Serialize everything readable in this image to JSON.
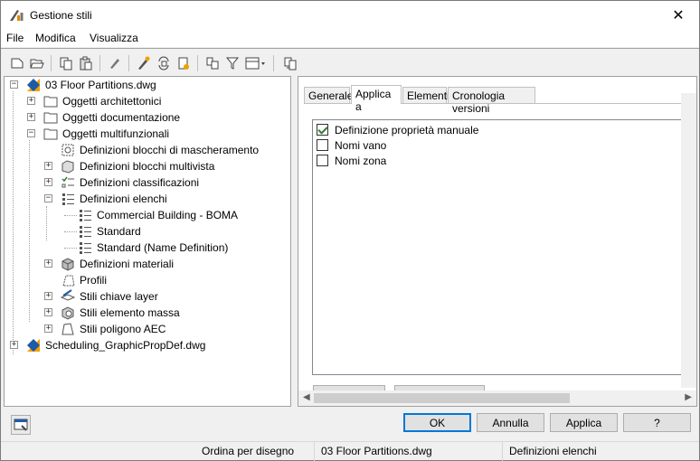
{
  "window": {
    "title": "Gestione stili",
    "close_glyph": "✕"
  },
  "menu": {
    "file": "File",
    "modifica": "Modifica",
    "visualizza": "Visualizza"
  },
  "tree": {
    "nodes": [
      {
        "label": "03 Floor Partitions.dwg",
        "icon": "drawing-icon",
        "expander": "−"
      },
      {
        "label": "Oggetti architettonici",
        "icon": "folder-icon",
        "expander": "+"
      },
      {
        "label": "Oggetti documentazione",
        "icon": "folder-icon",
        "expander": "+"
      },
      {
        "label": "Oggetti multifunzionali",
        "icon": "folder-icon",
        "expander": "−"
      },
      {
        "label": "Definizioni blocchi di mascheramento",
        "icon": "mask-block-icon",
        "expander": ""
      },
      {
        "label": "Definizioni blocchi multivista",
        "icon": "multiview-block-icon",
        "expander": "+"
      },
      {
        "label": "Definizioni classificazioni",
        "icon": "classification-icon",
        "expander": "+"
      },
      {
        "label": "Definizioni elenchi",
        "icon": "list-definition-icon",
        "expander": "−"
      },
      {
        "label": "Commercial Building - BOMA",
        "icon": "list-icon",
        "expander": ""
      },
      {
        "label": "Standard",
        "icon": "list-icon",
        "expander": ""
      },
      {
        "label": "Standard (Name Definition)",
        "icon": "list-icon",
        "expander": ""
      },
      {
        "label": "Definizioni materiali",
        "icon": "material-icon",
        "expander": "+"
      },
      {
        "label": "Profili",
        "icon": "profile-icon",
        "expander": ""
      },
      {
        "label": "Stili chiave layer",
        "icon": "layer-key-icon",
        "expander": "+"
      },
      {
        "label": "Stili elemento massa",
        "icon": "mass-element-icon",
        "expander": "+"
      },
      {
        "label": "Stili poligono AEC",
        "icon": "polygon-icon",
        "expander": "+"
      },
      {
        "label": "Scheduling_GraphicPropDef.dwg",
        "icon": "drawing-icon",
        "expander": "+"
      }
    ]
  },
  "tabs": [
    "Generale",
    "Applica a",
    "Elementi",
    "Cronologia versioni"
  ],
  "active_tab": "Applica a",
  "applies_to": [
    {
      "label": "Definizione proprietà manuale",
      "checked": true
    },
    {
      "label": "Nomi vano",
      "checked": false
    },
    {
      "label": "Nomi zona",
      "checked": false
    }
  ],
  "buttons": {
    "ok": "OK",
    "cancel": "Annulla",
    "apply": "Applica",
    "help": "?"
  },
  "status": {
    "sort": "Ordina per disegno",
    "drawing": "03 Floor Partitions.dwg",
    "selection": "Definizioni elenchi"
  },
  "colors": {
    "accent": "#0078d7",
    "check": "#2e7d32",
    "folder": "#ffffff"
  }
}
